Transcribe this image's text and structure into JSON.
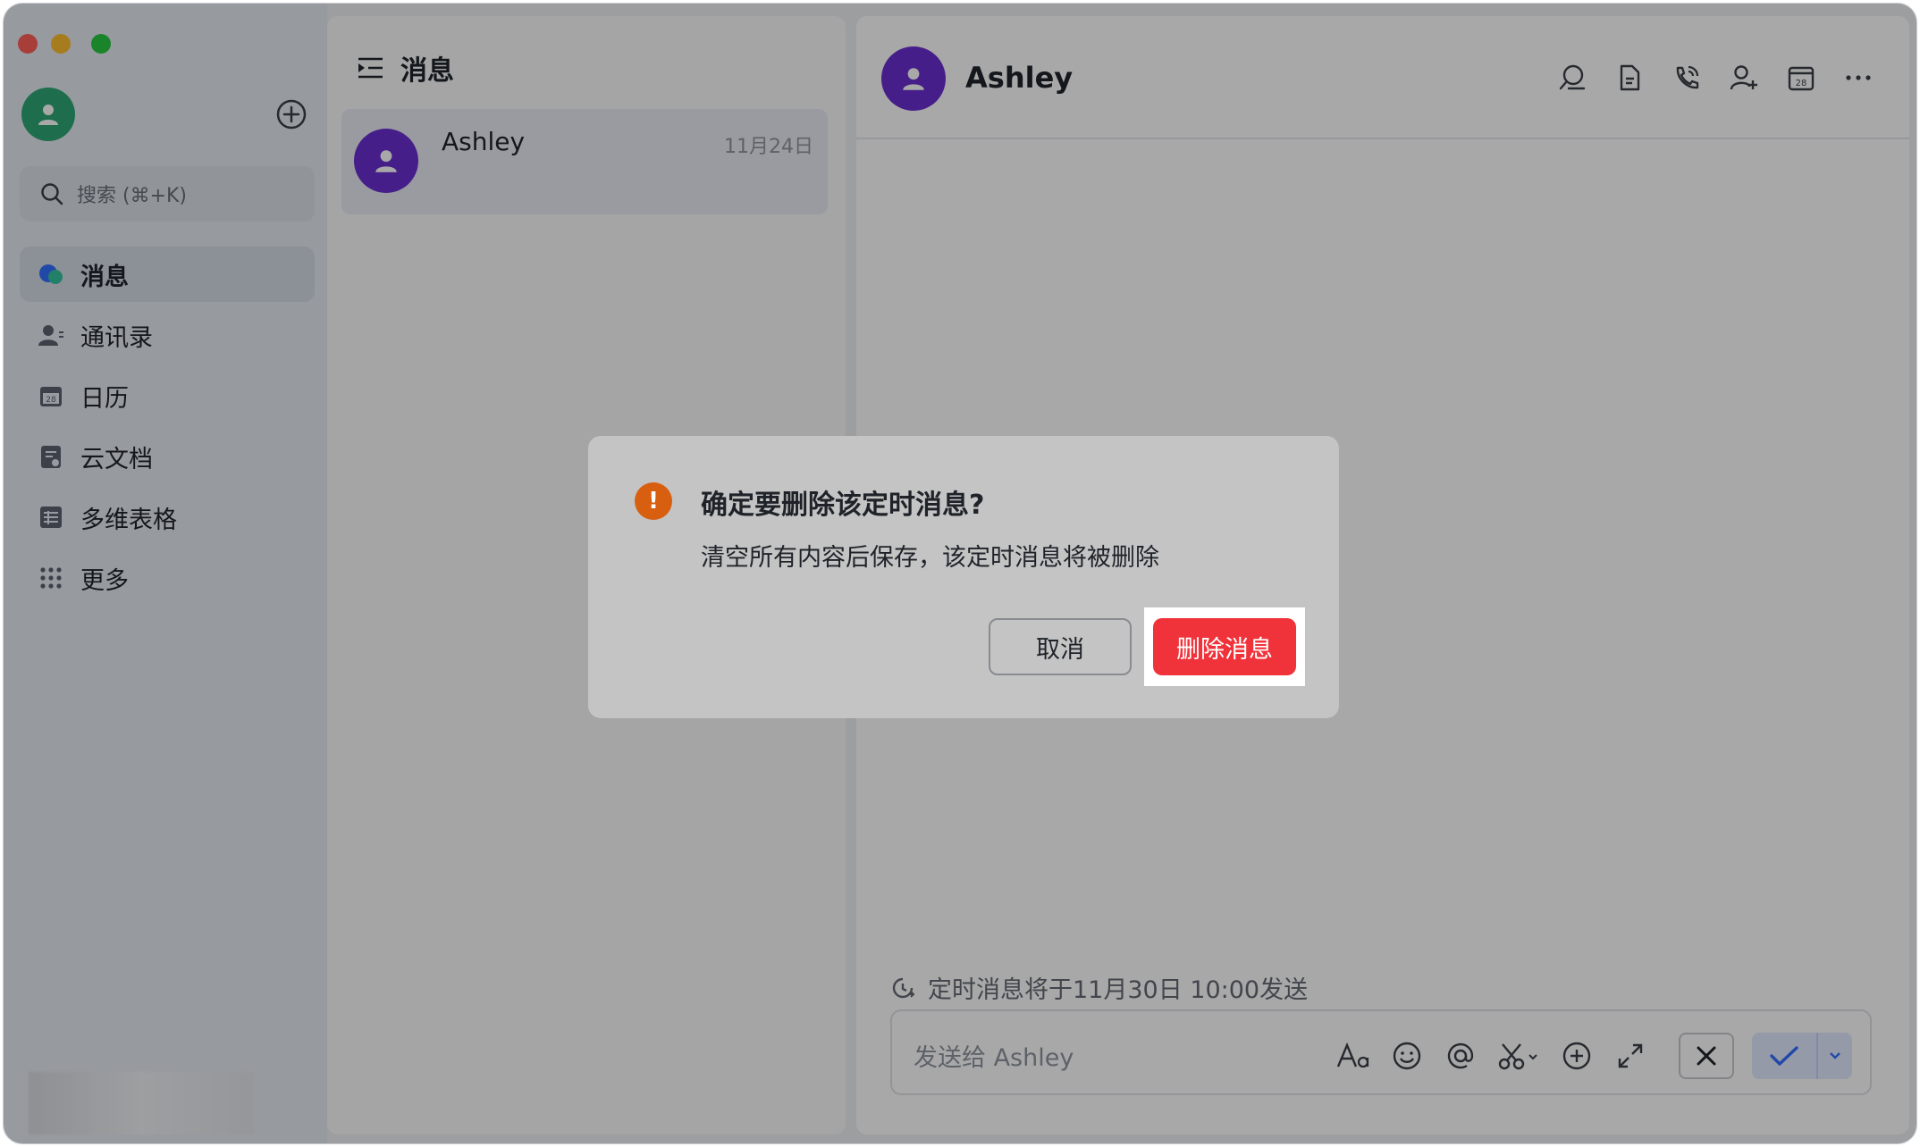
{
  "sidebar": {
    "search_placeholder": "搜索 (⌘+K)",
    "items": [
      {
        "label": "消息"
      },
      {
        "label": "通讯录"
      },
      {
        "label": "日历"
      },
      {
        "label": "云文档"
      },
      {
        "label": "多维表格"
      },
      {
        "label": "更多"
      }
    ]
  },
  "conversation_list": {
    "title": "消息",
    "items": [
      {
        "name": "Ashley",
        "date": "11月24日"
      }
    ]
  },
  "chat": {
    "contact_name": "Ashley",
    "scheduled_notice": "定时消息将于11月30日 10:00发送",
    "composer_placeholder": "发送给 Ashley"
  },
  "dialog": {
    "title": "确定要删除该定时消息?",
    "description": "清空所有内容后保存，该定时消息将被删除",
    "cancel_label": "取消",
    "delete_label": "删除消息"
  },
  "colors": {
    "accent_blue": "#3370ff",
    "danger_red": "#f0333a",
    "warning_orange": "#d85f10",
    "avatar_purple": "#6b2ed1",
    "avatar_green": "#2ea876"
  }
}
